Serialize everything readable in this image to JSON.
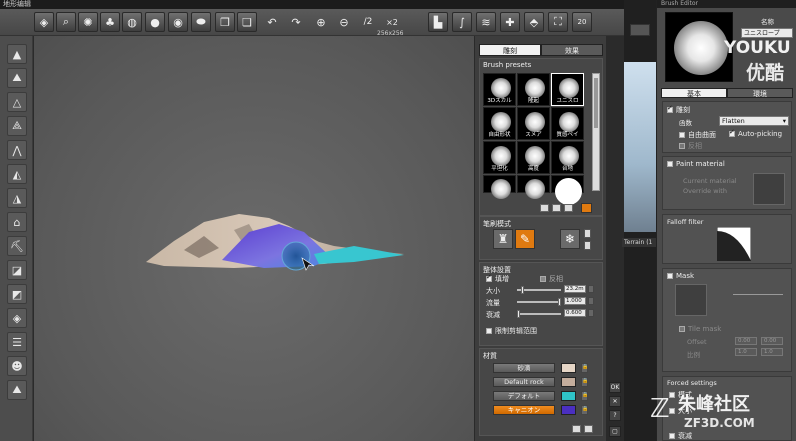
{
  "window": {
    "title": "地形编辑"
  },
  "toolbar": {
    "zoom_in_icon": "magnify-plus-icon",
    "half_label": "/2",
    "double_label": "×2",
    "badge_20": "20",
    "resolution_label": "256x256"
  },
  "panel": {
    "tabs": [
      {
        "label": "雕刻"
      },
      {
        "label": "效果"
      }
    ],
    "brush_presets": {
      "title": "Brush presets",
      "items": [
        {
          "label": "3Dスカル"
        },
        {
          "label": "隆起"
        },
        {
          "label": "ユニスロ"
        },
        {
          "label": "自由形状"
        },
        {
          "label": "スメア"
        },
        {
          "label": "質感ペイ"
        },
        {
          "label": "平坦化"
        },
        {
          "label": "高度"
        },
        {
          "label": "台地"
        },
        {
          "label": ""
        },
        {
          "label": ""
        },
        {
          "label": ""
        }
      ]
    },
    "stroke_mode": {
      "title": "笔刷模式"
    },
    "global_settings": {
      "title": "整体設置",
      "raise_label": "填增",
      "invert_label": "反相",
      "size_label": "大小",
      "size_value": "23.2m",
      "size_level": 0.1,
      "flow_label": "流量",
      "flow_value": "1.000",
      "flow_level": 1.0,
      "falloff_label": "衰减",
      "falloff_value": "0.600",
      "falloff_level": 0.0,
      "limit_label": "限制剪辑范围"
    },
    "materials": {
      "title": "材質",
      "items": [
        {
          "label": "砂滴",
          "color": "#e6d6c6"
        },
        {
          "label": "Default rock",
          "color": "#c4ad9c"
        },
        {
          "label": "デフォルト",
          "color": "#2fc4c8"
        },
        {
          "label": "キャニオン",
          "color": "#4a2fc0",
          "selected": true
        }
      ]
    }
  },
  "dialog": {
    "ok_label": "OK",
    "close_label": "✕",
    "help_label": "?"
  },
  "background": {
    "terrain_tab": "Terrain (1"
  },
  "editor": {
    "title": "Brush Editor",
    "name_label": "名称",
    "name_value": "ユニスロープ",
    "tabs": [
      {
        "label": "基本"
      },
      {
        "label": "環境"
      }
    ],
    "sculpt_label": "雕刻",
    "function_label": "函数",
    "function_value": "Flatten",
    "free_surface_label": "自由曲面",
    "autopicking_label": "Auto-picking",
    "invert_label": "反相",
    "paint_material_label": "Paint material",
    "current_material_label": "Current material",
    "override_label": "Override with",
    "falloff_filter_label": "Falloff filter",
    "mask_label": "Mask",
    "tile_mask_label": "Tile mask",
    "offset_label": "Offset",
    "offset_x": "0.00",
    "offset_y": "0.00",
    "ratio_label": "比例",
    "ratio_x": "1.0",
    "ratio_y": "1.0",
    "forced_label": "Forced settings",
    "mode_label": "模式",
    "size_label": "大小",
    "falloff_label": "衰减"
  },
  "watermarks": {
    "youku": "YOUKU",
    "youku_cn": "优酷",
    "zf_name": "朱峰社区",
    "zf_site": "ZF3D.COM"
  },
  "colors": {
    "selected_orange": "#e07a10",
    "panel_bg": "#3d3d3d"
  }
}
